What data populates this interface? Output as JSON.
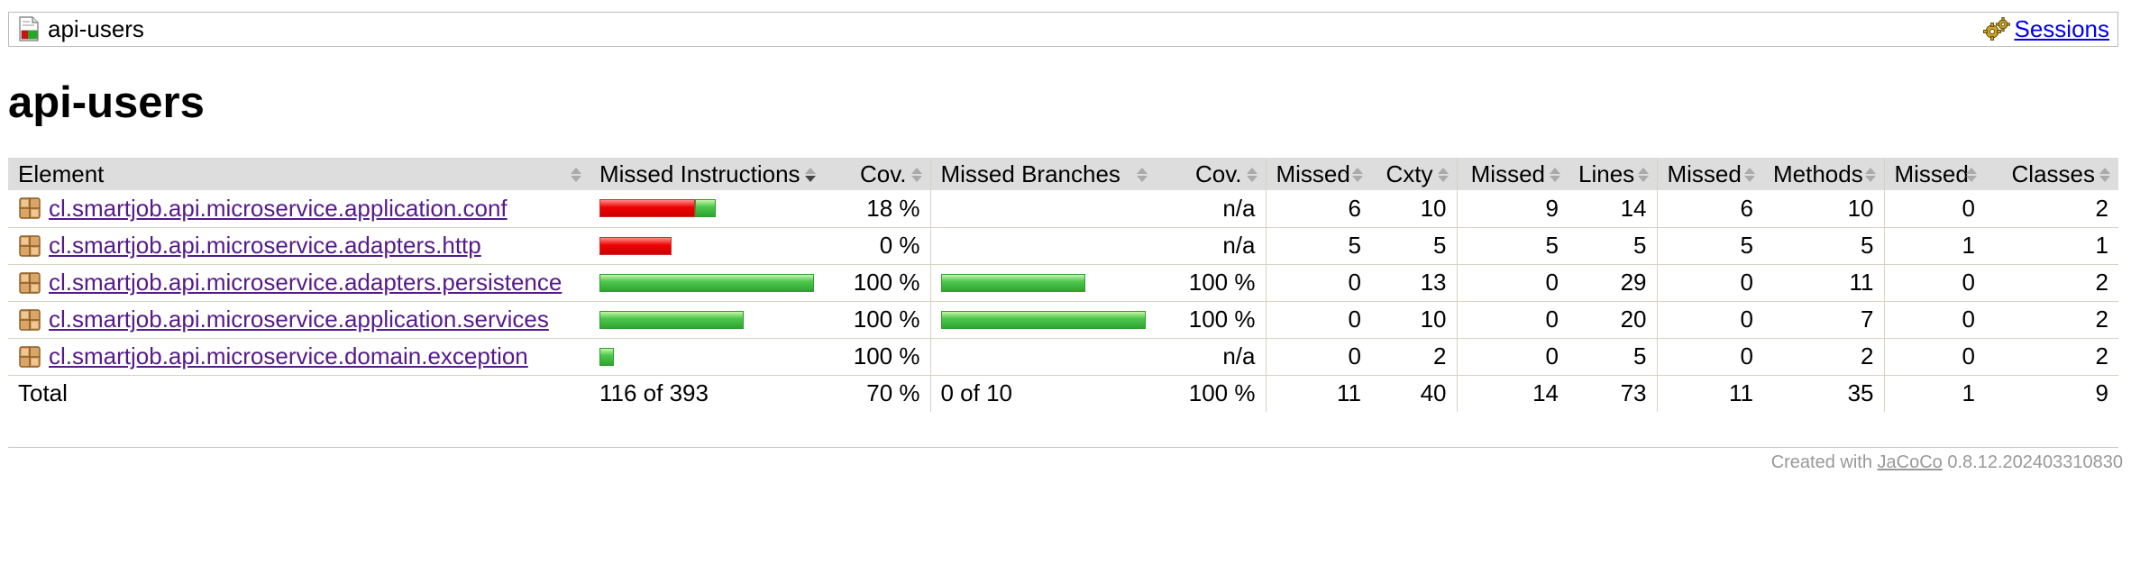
{
  "breadcrumb": {
    "title": "api-users",
    "sessions_label": "Sessions"
  },
  "page_title": "api-users",
  "table": {
    "headers": {
      "element": "Element",
      "missed_instructions": "Missed Instructions",
      "cov_instructions": "Cov.",
      "missed_branches": "Missed Branches",
      "cov_branches": "Cov.",
      "missed_cxty": "Missed",
      "cxty": "Cxty",
      "missed_lines": "Missed",
      "lines": "Lines",
      "missed_methods": "Missed",
      "methods": "Methods",
      "missed_classes": "Missed",
      "classes": "Classes"
    },
    "rows": [
      {
        "name": "cl.smartjob.api.microservice.application.conf",
        "instr_missed": 107,
        "instr_covered": 23,
        "instr_cov": "18 %",
        "branch_missed": 0,
        "branch_covered": 0,
        "branch_cov": "n/a",
        "missed_cxty": "6",
        "cxty": "10",
        "missed_lines": "9",
        "lines": "14",
        "missed_methods": "6",
        "methods": "10",
        "missed_classes": "0",
        "classes": "2"
      },
      {
        "name": "cl.smartjob.api.microservice.adapters.http",
        "instr_missed": 81,
        "instr_covered": 0,
        "instr_cov": "0 %",
        "branch_missed": 0,
        "branch_covered": 0,
        "branch_cov": "n/a",
        "missed_cxty": "5",
        "cxty": "5",
        "missed_lines": "5",
        "lines": "5",
        "missed_methods": "5",
        "methods": "5",
        "missed_classes": "1",
        "classes": "1"
      },
      {
        "name": "cl.smartjob.api.microservice.adapters.persistence",
        "instr_missed": 0,
        "instr_covered": 243,
        "instr_cov": "100 %",
        "branch_missed": 0,
        "branch_covered": 4,
        "branch_cov": "100 %",
        "missed_cxty": "0",
        "cxty": "13",
        "missed_lines": "0",
        "lines": "29",
        "missed_methods": "0",
        "methods": "11",
        "missed_classes": "0",
        "classes": "2"
      },
      {
        "name": "cl.smartjob.api.microservice.application.services",
        "instr_missed": 0,
        "instr_covered": 162,
        "instr_cov": "100 %",
        "branch_missed": 0,
        "branch_covered": 6,
        "branch_cov": "100 %",
        "missed_cxty": "0",
        "cxty": "10",
        "missed_lines": "0",
        "lines": "20",
        "missed_methods": "0",
        "methods": "7",
        "missed_classes": "0",
        "classes": "2"
      },
      {
        "name": "cl.smartjob.api.microservice.domain.exception",
        "instr_missed": 0,
        "instr_covered": 16,
        "instr_cov": "100 %",
        "branch_missed": 0,
        "branch_covered": 0,
        "branch_cov": "n/a",
        "missed_cxty": "0",
        "cxty": "2",
        "missed_lines": "0",
        "lines": "5",
        "missed_methods": "0",
        "methods": "2",
        "missed_classes": "0",
        "classes": "2"
      }
    ],
    "total": {
      "label": "Total",
      "instr": "116 of 393",
      "instr_cov": "70 %",
      "branch": "0 of 10",
      "branch_cov": "100 %",
      "missed_cxty": "11",
      "cxty": "40",
      "missed_lines": "14",
      "lines": "73",
      "missed_methods": "11",
      "methods": "35",
      "missed_classes": "1",
      "classes": "9"
    }
  },
  "footer": {
    "prefix": "Created with",
    "link": "JaCoCo",
    "version": "0.8.12.202403310830"
  },
  "colors": {
    "header_bg": "#dddddd",
    "link": "#0000ee",
    "visited_link": "#551a8b",
    "bar_red": "#ee0000",
    "bar_green": "#4fc84f",
    "footer_text": "#999999"
  }
}
